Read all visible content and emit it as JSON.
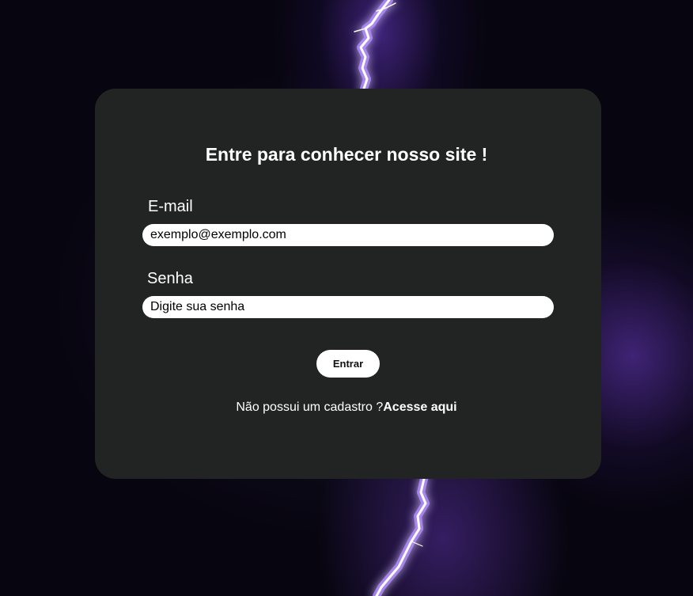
{
  "background": {
    "description_icon": "purple-lightning-background",
    "accent_color": "#a070ff"
  },
  "card": {
    "background_color": "#222424",
    "title": "Entre para conhecer nosso site !"
  },
  "form": {
    "email": {
      "label": "E-mail",
      "placeholder": "exemplo@exemplo.com"
    },
    "password": {
      "label": "Senha",
      "placeholder": "Digite sua senha"
    },
    "submit_label": "Entrar"
  },
  "signup": {
    "prompt": "Não possui um cadastro ?",
    "link_label": "Acesse aqui"
  }
}
